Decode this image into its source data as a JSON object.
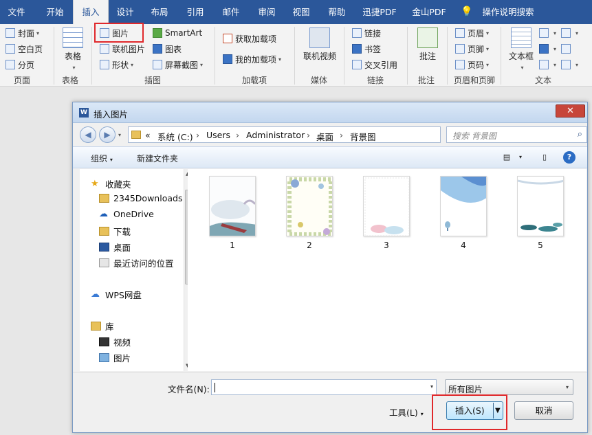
{
  "ribbon_tabs": [
    "文件",
    "开始",
    "插入",
    "设计",
    "布局",
    "引用",
    "邮件",
    "审阅",
    "视图",
    "帮助",
    "迅捷PDF",
    "金山PDF",
    "操作说明搜索"
  ],
  "ribbon": {
    "page": {
      "cover": "封面",
      "blank": "空白页",
      "break": "分页",
      "label": "页面"
    },
    "table": {
      "table": "表格",
      "label": "表格"
    },
    "illustrations": {
      "picture": "图片",
      "online_picture": "联机图片",
      "shapes": "形状",
      "smartart": "SmartArt",
      "chart": "图表",
      "screenshot": "屏幕截图",
      "label": "插图"
    },
    "addins": {
      "get": "获取加载项",
      "mine": "我的加载项",
      "label": "加载项"
    },
    "media": {
      "online_video": "联机视频",
      "label": "媒体"
    },
    "links": {
      "link": "链接",
      "bookmark": "书签",
      "cross_ref": "交叉引用",
      "label": "链接"
    },
    "comments": {
      "comment": "批注",
      "label": "批注"
    },
    "header_footer": {
      "header": "页眉",
      "footer": "页脚",
      "page_number": "页码",
      "label": "页眉和页脚"
    },
    "text": {
      "textbox": "文本框",
      "label": "文本"
    }
  },
  "dialog": {
    "title": "插入图片",
    "close": "✕",
    "breadcrumbs": [
      "«",
      "系统 (C:)",
      "Users",
      "Administrator",
      "桌面",
      "背景图"
    ],
    "search_placeholder": "搜索 背景图",
    "toolbar": {
      "organize": "组织",
      "new_folder": "新建文件夹"
    },
    "nav": {
      "favorites": "收藏夹",
      "items": [
        "2345Downloads",
        "OneDrive",
        "下载",
        "桌面",
        "最近访问的位置"
      ],
      "wps": "WPS网盘",
      "library": "库",
      "library_items": [
        "视频",
        "图片"
      ]
    },
    "files": [
      "1",
      "2",
      "3",
      "4",
      "5"
    ],
    "filename_label": "文件名(N):",
    "filename_value": "",
    "filetype": "所有图片",
    "tools": "工具(L)",
    "insert": "插入(S)",
    "cancel": "取消"
  },
  "colors": {
    "ribbon_blue": "#2b579a",
    "highlight_red": "#e0282b"
  }
}
